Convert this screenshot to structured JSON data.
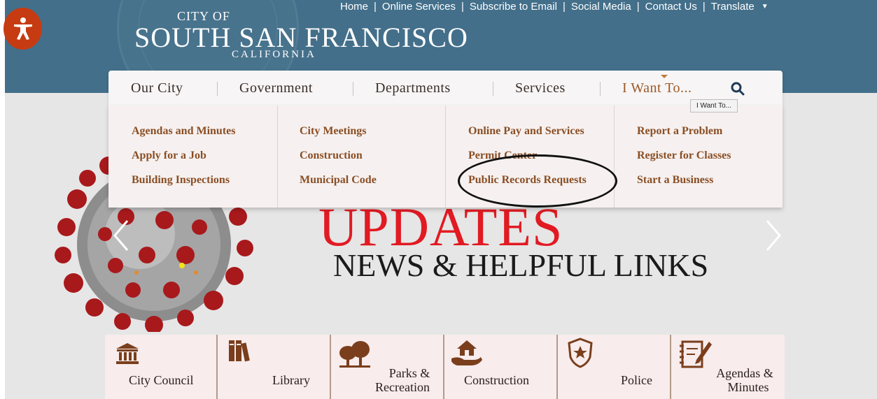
{
  "header": {
    "city_of": "CITY OF",
    "city_name": "SOUTH SAN FRANCISCO",
    "state": "CALIFORNIA",
    "top_links": [
      "Home",
      "Online Services",
      "Subscribe to Email",
      "Social Media",
      "Contact Us",
      "Translate"
    ],
    "separator": "|",
    "background_color": "#436f8a"
  },
  "accessibility": {
    "icon": "accessibility-person-icon",
    "color": "#c63b12"
  },
  "nav": {
    "items": [
      "Our City",
      "Government",
      "Departments",
      "Services",
      "I Want To..."
    ],
    "active_item": "I Want To...",
    "search_icon": "search-icon",
    "tooltip": "I Want To..."
  },
  "dropdown": {
    "columns": [
      [
        "Agendas and Minutes",
        "Apply for a Job",
        "Building Inspections"
      ],
      [
        "City Meetings",
        "Construction",
        "Municipal Code"
      ],
      [
        "Online Pay and Services",
        "Permit Center",
        "Public Records Requests"
      ],
      [
        "Report a Problem",
        "Register for Classes",
        "Start a Business"
      ]
    ],
    "link_color": "#8a4e24",
    "highlighted": "Public Records Requests"
  },
  "slide": {
    "title": "UPDATES",
    "subtitle": "NEWS & HELPFUL LINKS",
    "title_color": "#e21a22",
    "prev_icon": "chevron-left-icon",
    "next_icon": "chevron-right-icon"
  },
  "quick_links": [
    {
      "label": "City Council",
      "icon": "city-hall-icon"
    },
    {
      "label": "Library",
      "icon": "books-icon"
    },
    {
      "label_line1": "Parks &",
      "label_line2": "Recreation",
      "icon": "trees-icon"
    },
    {
      "label": "Construction",
      "icon": "house-in-hand-icon"
    },
    {
      "label": "Police",
      "icon": "police-badge-icon"
    },
    {
      "label_line1": "Agendas &",
      "label_line2": "Minutes",
      "icon": "notepad-icon"
    }
  ]
}
